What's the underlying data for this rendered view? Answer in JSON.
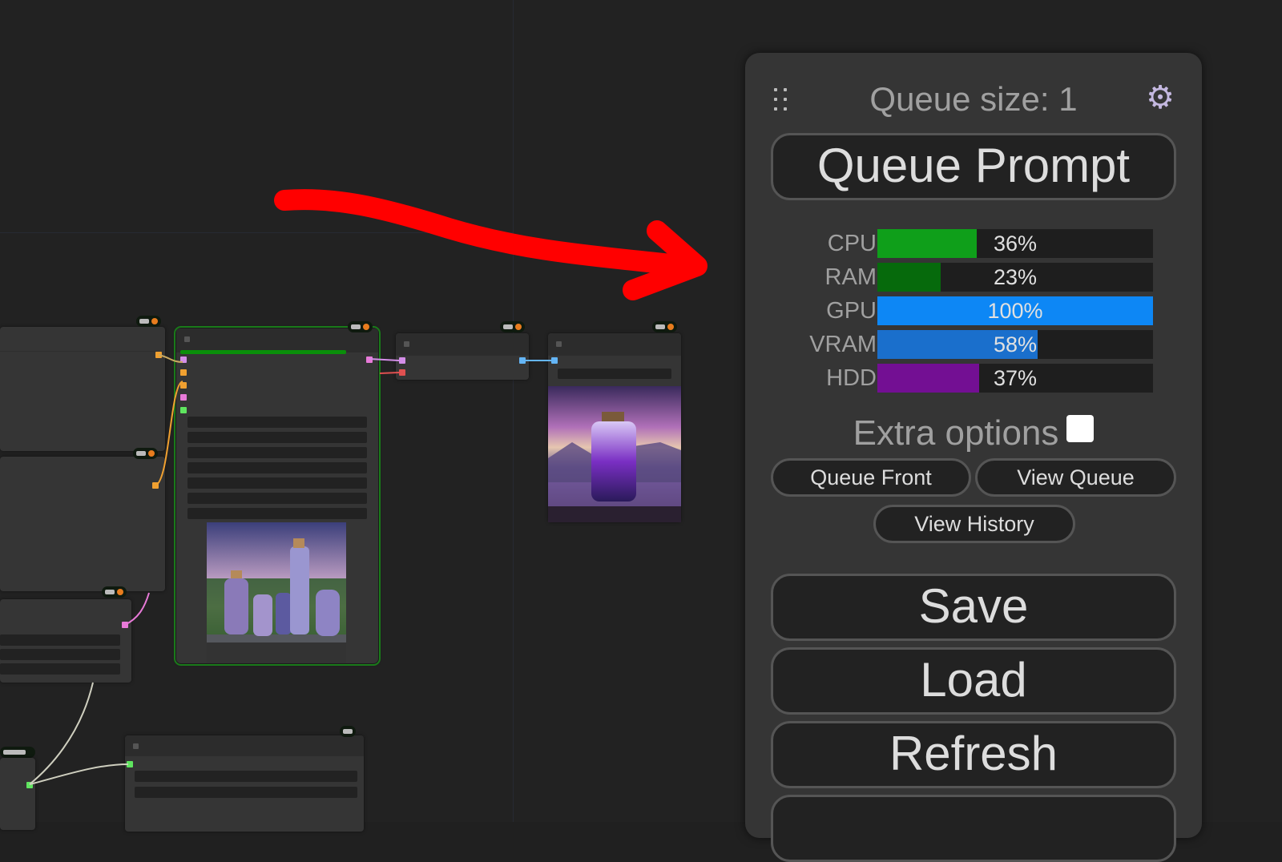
{
  "panel": {
    "queue_size_label": "Queue size: 1",
    "settings_icon": "gear-icon",
    "drag_icon": "drag-handle-icon",
    "queue_prompt_label": "Queue Prompt",
    "stats": [
      {
        "label": "CPU",
        "value": "36%",
        "percent": 36,
        "color": "#0f9f1a"
      },
      {
        "label": "RAM",
        "value": "23%",
        "percent": 23,
        "color": "#066a0c"
      },
      {
        "label": "GPU",
        "value": "100%",
        "percent": 100,
        "color": "#0d87f5"
      },
      {
        "label": "VRAM",
        "value": "58%",
        "percent": 58,
        "color": "#1a6fcc"
      },
      {
        "label": "HDD",
        "value": "37%",
        "percent": 37,
        "color": "#730f93"
      }
    ],
    "extra_options_label": "Extra options",
    "extra_options_checked": false,
    "queue_front_label": "Queue Front",
    "view_queue_label": "View Queue",
    "view_history_label": "View History",
    "save_label": "Save",
    "load_label": "Load",
    "refresh_label": "Refresh"
  },
  "annotation": {
    "arrow_color": "#ff0000"
  },
  "colors": {
    "selected_node_outline": "#1a7a1a",
    "progress_bar": "#0a8f0a",
    "slot_model": "#d48ee8",
    "slot_conditioning": "#f0a030",
    "slot_latent": "#e87ad8",
    "slot_vae": "#e05050",
    "slot_image": "#64b5f6",
    "slot_clip": "#5fe55f"
  }
}
